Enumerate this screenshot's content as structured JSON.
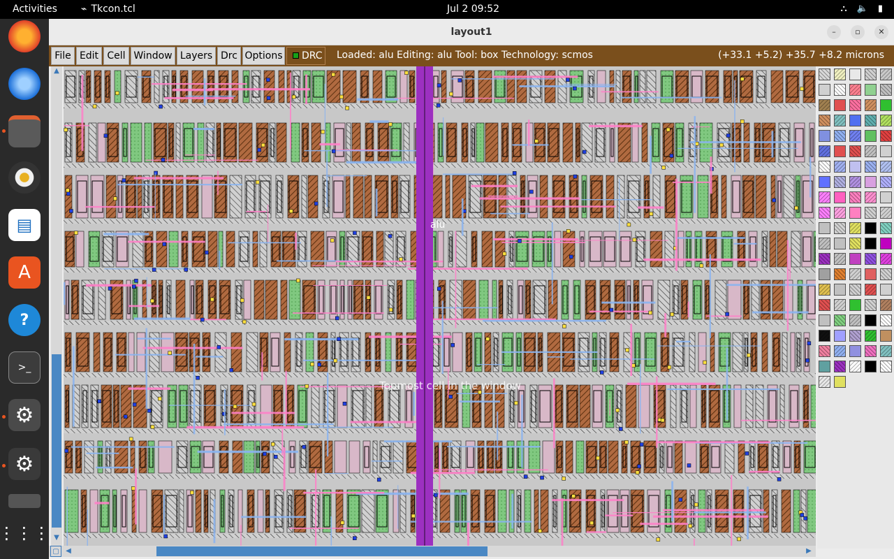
{
  "topbar": {
    "activities": "Activities",
    "app_name": "Tkcon.tcl",
    "clock": "Jul 2  09:52",
    "tray_icons": [
      "network-icon",
      "volume-icon",
      "battery-icon"
    ]
  },
  "dock": {
    "items": [
      "firefox-icon",
      "thunderbird-icon",
      "files-icon",
      "rhythmbox-icon",
      "writer-icon",
      "app-center-icon",
      "help-icon",
      "terminal-icon",
      "settings-icon",
      "settings-icon",
      "drive-icon",
      "show-apps-icon"
    ]
  },
  "window": {
    "title": "layout1",
    "menus": [
      "File",
      "Edit",
      "Cell",
      "Window",
      "Layers",
      "Drc",
      "Options"
    ],
    "drc_label": "DRC",
    "status": "Loaded: alu Editing: alu Tool: box  Technology: scmos",
    "coordinates": "(+33.1 +5.2) +35.7 +8.2 microns"
  },
  "canvas": {
    "cell_name": "alu",
    "overlay_text": "Topmost cell in the window"
  },
  "colors": {
    "menu_bar": "#7a4f1c",
    "accent": "#4a88c4",
    "metal1": "#8ab4f0",
    "poly": "#ff80c8",
    "diffusion": "#b06a40",
    "ndiff": "#80c880",
    "via": "#9c30c0"
  }
}
